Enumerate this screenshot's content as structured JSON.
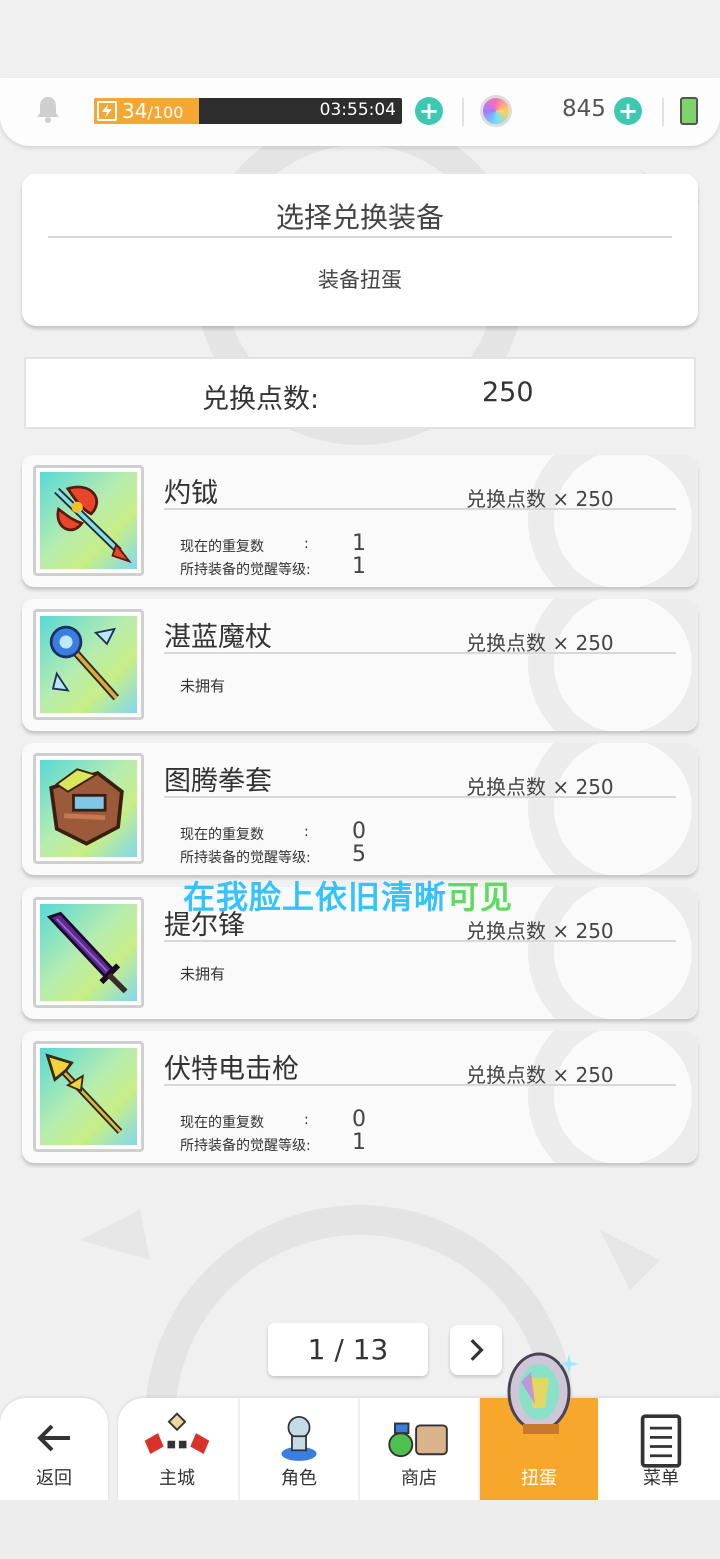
{
  "status_bar": {
    "stamina_current": "34",
    "stamina_max": "/100",
    "stamina_fraction": 0.34,
    "stamina_timer": "03:55:04",
    "gem_count": "845"
  },
  "header": {
    "title": "选择兑换装备",
    "subtitle": "装备扭蛋"
  },
  "points": {
    "label": "兑换点数:",
    "value": "250"
  },
  "labels": {
    "duplicates": "现在的重复数",
    "awaken_level": "所持装备的觉醒等级:",
    "colon": ":",
    "not_owned": "未拥有"
  },
  "items": [
    {
      "name": "灼钺",
      "cost": "兑换点数 × 250",
      "owned": true,
      "duplicates": "1",
      "awaken": "1",
      "icon": "axe-icon"
    },
    {
      "name": "湛蓝魔杖",
      "cost": "兑换点数 × 250",
      "owned": false,
      "icon": "staff-icon"
    },
    {
      "name": "图腾拳套",
      "cost": "兑换点数 × 250",
      "owned": true,
      "duplicates": "0",
      "awaken": "5",
      "icon": "gauntlet-icon"
    },
    {
      "name": "提尔锋",
      "cost": "兑换点数 × 250",
      "owned": false,
      "icon": "sword-icon"
    },
    {
      "name": "伏特电击枪",
      "cost": "兑换点数 × 250",
      "owned": true,
      "duplicates": "0",
      "awaken": "1",
      "icon": "spear-icon"
    }
  ],
  "overlay": {
    "part1": "在我脸上依旧清晰",
    "part2": "可见"
  },
  "pager": {
    "text": "1 / 13"
  },
  "nav": {
    "back": "返回",
    "city": "主城",
    "character": "角色",
    "shop": "商店",
    "gacha": "扭蛋",
    "menu": "菜单"
  },
  "colors": {
    "accent_orange": "#f7a72b",
    "accent_teal": "#3cc9b0",
    "overlay_blue": "#35c3ff",
    "overlay_green": "#5fdc5f"
  }
}
